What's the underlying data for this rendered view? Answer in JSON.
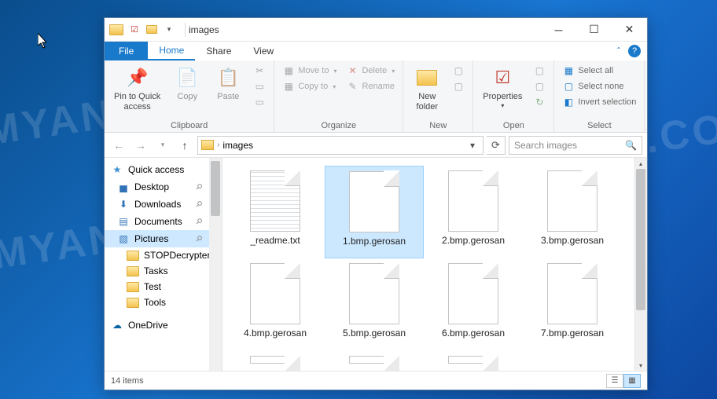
{
  "window": {
    "title": "images"
  },
  "tabs": {
    "file": "File",
    "home": "Home",
    "share": "Share",
    "view": "View"
  },
  "ribbon": {
    "clipboard": {
      "label": "Clipboard",
      "pin": "Pin to Quick\naccess",
      "copy": "Copy",
      "paste": "Paste"
    },
    "organize": {
      "label": "Organize",
      "moveto": "Move to",
      "copyto": "Copy to",
      "delete": "Delete",
      "rename": "Rename"
    },
    "new": {
      "label": "New",
      "newfolder": "New\nfolder"
    },
    "open": {
      "label": "Open",
      "properties": "Properties"
    },
    "select": {
      "label": "Select",
      "selectall": "Select all",
      "selectnone": "Select none",
      "invert": "Invert selection"
    }
  },
  "address": {
    "crumb": "images",
    "search_placeholder": "Search images"
  },
  "sidebar": {
    "quick_access": "Quick access",
    "desktop": "Desktop",
    "downloads": "Downloads",
    "documents": "Documents",
    "pictures": "Pictures",
    "stopdecrypter": "STOPDecrypter",
    "tasks": "Tasks",
    "test": "Test",
    "tools": "Tools",
    "onedrive": "OneDrive"
  },
  "files": [
    {
      "name": "_readme.txt",
      "type": "txt"
    },
    {
      "name": "1.bmp.gerosan",
      "type": "blank",
      "selected": true
    },
    {
      "name": "2.bmp.gerosan",
      "type": "blank"
    },
    {
      "name": "3.bmp.gerosan",
      "type": "blank"
    },
    {
      "name": "4.bmp.gerosan",
      "type": "blank"
    },
    {
      "name": "5.bmp.gerosan",
      "type": "blank"
    },
    {
      "name": "6.bmp.gerosan",
      "type": "blank"
    },
    {
      "name": "7.bmp.gerosan",
      "type": "blank"
    }
  ],
  "status": {
    "count": "14 items"
  }
}
